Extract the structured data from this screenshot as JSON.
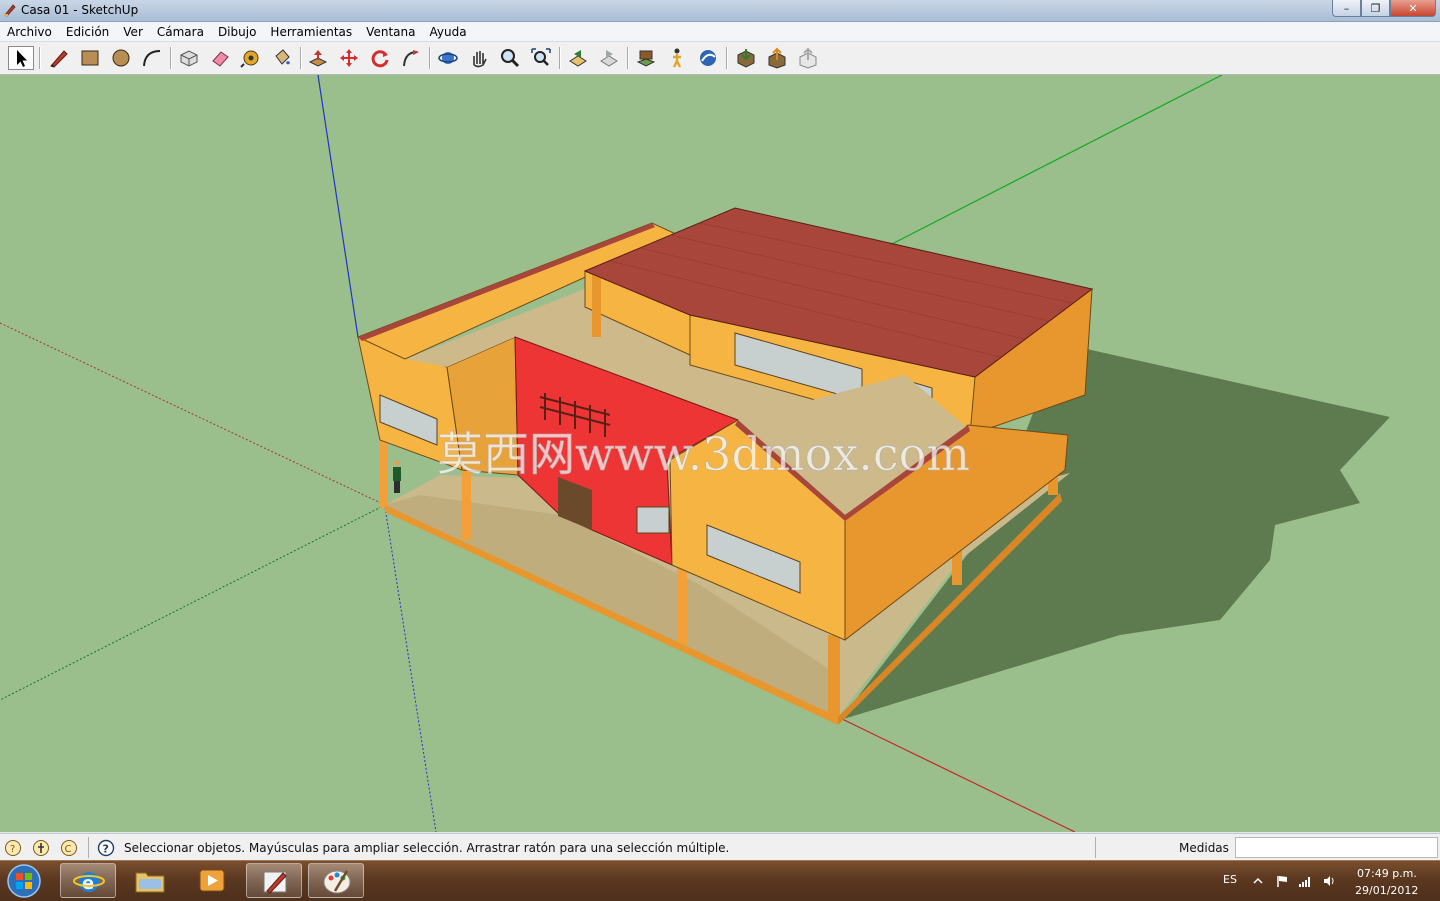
{
  "window": {
    "title": "Casa 01 - SketchUp",
    "controls": [
      "–",
      "❐",
      "✕"
    ]
  },
  "menu": [
    "Archivo",
    "Edición",
    "Ver",
    "Cámara",
    "Dibujo",
    "Herramientas",
    "Ventana",
    "Ayuda"
  ],
  "toolbar": {
    "tools": [
      "select-tool",
      "pencil-line-tool",
      "rectangle-tool",
      "circle-tool",
      "arc-tool",
      "make-component-tool",
      "eraser-tool",
      "tape-measure-tool",
      "paint-bucket-tool",
      "push-pull-tool",
      "move-tool",
      "rotate-tool",
      "follow-me-tool",
      "orbit-tool",
      "pan-tool",
      "zoom-tool",
      "zoom-extents-tool",
      "previous-view-tool",
      "next-view-tool",
      "position-camera-tool",
      "walk-tool",
      "look-around-tool",
      "get-models-tool",
      "share-model-tool",
      "share-component-tool"
    ]
  },
  "viewport": {
    "watermark": "莫西网www.3dmox.com",
    "colors": {
      "ground": "#9abf8c",
      "roof": "#a8463c",
      "wall": "#f6b543",
      "accent_wall": "#ee3535",
      "floor": "#c9b98b"
    }
  },
  "status": {
    "message": "Seleccionar objetos. Mayúsculas para ampliar selección. Arrastrar ratón para una selección múltiple.",
    "measure_label": "Medidas",
    "measure_value": ""
  },
  "taskbar": {
    "apps": [
      "internet-explorer",
      "file-explorer",
      "media-player",
      "sketchup",
      "paint"
    ],
    "language": "ES",
    "time": "07:49 p.m.",
    "date": "29/01/2012"
  }
}
